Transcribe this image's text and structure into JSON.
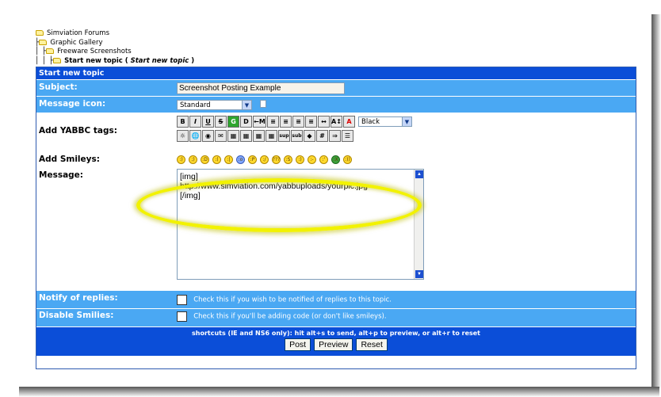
{
  "breadcrumb": {
    "items": [
      "Simviation Forums",
      "Graphic Gallery",
      "Freeware Screenshots"
    ],
    "current": "Start new topic",
    "current_paren": "Start new topic"
  },
  "form": {
    "title": "Start new topic",
    "subject_label": "Subject:",
    "subject_value": "Screenshot Posting Example",
    "icon_label": "Message icon:",
    "icon_value": "Standard",
    "tags_label": "Add YABBC tags:",
    "color_value": "Black",
    "smileys_label": "Add Smileys:",
    "message_label": "Message:",
    "message_lines": [
      "[img]",
      "http://www.simviation.com/yabbuploads/yourpic.jpg",
      "[/img]"
    ],
    "notify_label": "Notify of replies:",
    "notify_text": "Check this if you wish to be notified of replies to this topic.",
    "nosmile_label": "Disable Smilies:",
    "nosmile_text": "Check this if you'll be adding code (or don't like smileys).",
    "shortcuts": "shortcuts (IE and NS6 only): hit alt+s to send, alt+p to preview, or alt+r to reset",
    "post": "Post",
    "preview": "Preview",
    "reset": "Reset"
  },
  "toolbar": {
    "row1": [
      "B",
      "I",
      "U",
      "S",
      "G",
      "D",
      "←M",
      "≡",
      "≡",
      "≡",
      "≡",
      "↔",
      "A↕",
      "A"
    ],
    "row2": [
      "☼",
      "🌐",
      "◉",
      "✉",
      "▦",
      "▦",
      "▦",
      "▦",
      "sup",
      "sub",
      "◆",
      "#",
      "⇒",
      "☰"
    ]
  },
  "smileys": [
    ":)",
    ";)",
    ":D",
    ":(",
    ":|",
    ":o",
    ":P",
    ":/",
    "???",
    ":S",
    ":)",
    ":-",
    ":'",
    ":X",
    ":))"
  ],
  "colors": {
    "title_bar": "#0b4ed8",
    "row_blue": "#4aa8f3",
    "highlight": "#f2f200"
  }
}
